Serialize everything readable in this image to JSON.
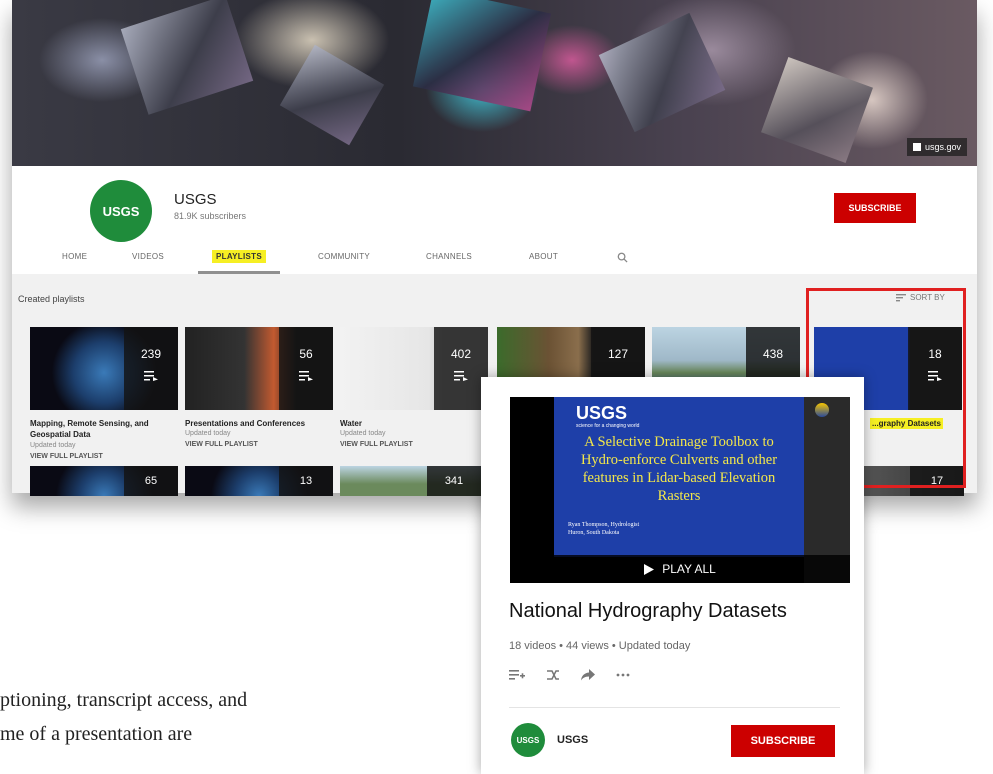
{
  "channel": {
    "banner_link": "usgs.gov",
    "logo_text": "USGS",
    "name": "USGS",
    "subscribers": "81.9K subscribers",
    "subscribe_label": "SUBSCRIBE"
  },
  "tabs": [
    {
      "label": "HOME"
    },
    {
      "label": "VIDEOS"
    },
    {
      "label": "PLAYLISTS",
      "active": true
    },
    {
      "label": "COMMUNITY"
    },
    {
      "label": "CHANNELS"
    },
    {
      "label": "ABOUT"
    }
  ],
  "section": {
    "title": "Created playlists",
    "sort_label": "SORT BY"
  },
  "playlists": [
    {
      "count": "239",
      "title": "Mapping, Remote Sensing, and Geospatial Data",
      "updated": "Updated today",
      "view": "VIEW FULL PLAYLIST"
    },
    {
      "count": "56",
      "title": "Presentations and Conferences",
      "updated": "Updated today",
      "view": "VIEW FULL PLAYLIST"
    },
    {
      "count": "402",
      "title": "Water",
      "updated": "Updated today",
      "view": "VIEW FULL PLAYLIST"
    },
    {
      "count": "127"
    },
    {
      "count": "438"
    },
    {
      "count": "18",
      "title": "...graphy Datasets"
    }
  ],
  "row2_counts": [
    "65",
    "13",
    "341",
    "17"
  ],
  "popup": {
    "slide": {
      "brand": "USGS",
      "tagline": "science for a changing world",
      "title": "A Selective Drainage Toolbox to Hydro-enforce Culverts and other features in Lidar-based Elevation Rasters",
      "author": "Ryan Thompson, Hydrologist",
      "location": "Huron, South Dakota"
    },
    "play_all": "PLAY ALL",
    "title": "National Hydrography Datasets",
    "meta": "18 videos • 44 views • Updated today",
    "owner": "USGS",
    "logo_text": "USGS",
    "subscribe_label": "SUBSCRIBE"
  },
  "doc_text": {
    "line1": "ptioning, transcript access, and",
    "line2": "me of a presentation are"
  },
  "colors": {
    "brand_red": "#cc0000",
    "usgs_green": "#1f8c3b",
    "highlight": "#f6ef23",
    "annotation_red": "#e02020"
  }
}
